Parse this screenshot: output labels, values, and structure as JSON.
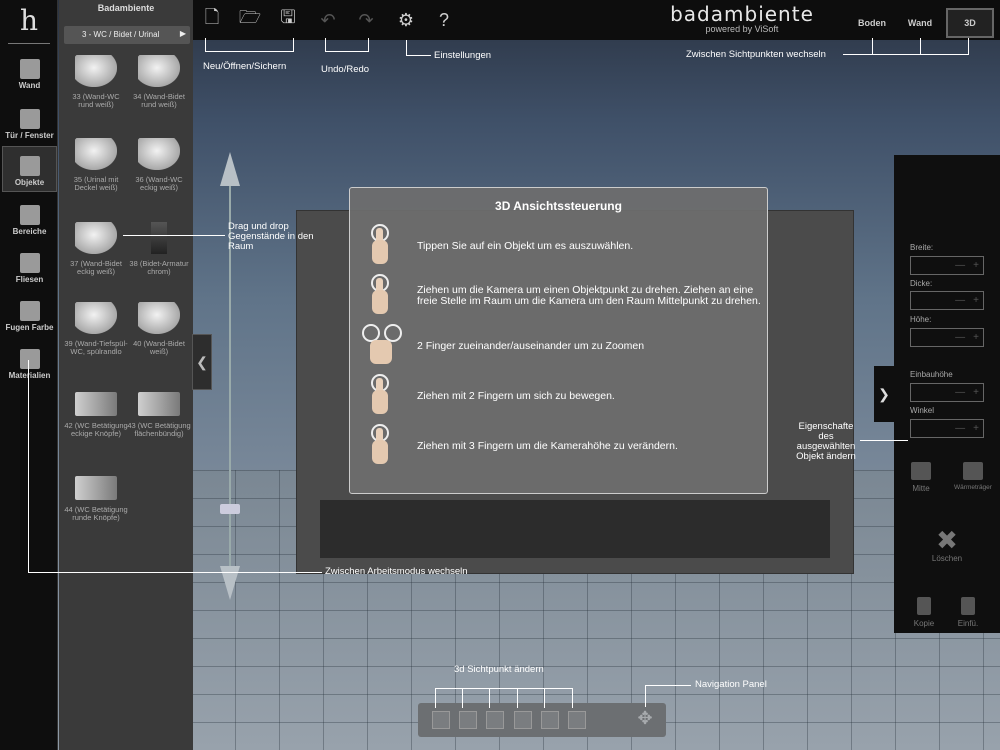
{
  "app": {
    "brand_name": "badambiente",
    "brand_sub": "powered by ViSoft"
  },
  "views": {
    "floor": "Boden",
    "wall": "Wand",
    "three_d": "3D",
    "active": "3D"
  },
  "modes": [
    {
      "label": "Wand",
      "icon": "wall-icon"
    },
    {
      "label": "Tür / Fenster",
      "icon": "door-icon"
    },
    {
      "label": "Objekte",
      "icon": "objects-icon"
    },
    {
      "label": "Bereiche",
      "icon": "areas-icon"
    },
    {
      "label": "Fliesen",
      "icon": "tiles-icon"
    },
    {
      "label": "Fugen Farbe",
      "icon": "grout-icon"
    },
    {
      "label": "Materialien",
      "icon": "materials-icon"
    }
  ],
  "catalog": {
    "title": "Badambiente",
    "category": "3 - WC / Bidet / Urinal",
    "items": [
      {
        "label": "33 (Wand-WC rund weiß)"
      },
      {
        "label": "34 (Wand-Bidet rund weiß)"
      },
      {
        "label": "35 (Urinal mit Deckel weiß)"
      },
      {
        "label": "36 (Wand-WC eckig weiß)"
      },
      {
        "label": "37 (Wand-Bidet eckig weiß)"
      },
      {
        "label": "38 (Bidet-Armatur chrom)"
      },
      {
        "label": "39 (Wand-Tiefspül-WC, spülrandlo"
      },
      {
        "label": "40 (Wand-Bidet weiß)"
      },
      {
        "label": "42 (WC Betätigung eckige Knöpfe)"
      },
      {
        "label": "43 (WC Betätigung flächenbündig)"
      },
      {
        "label": "44 (WC Betätigung runde Knöpfe)"
      }
    ]
  },
  "dialog": {
    "title": "3D Ansichtssteuerung",
    "hints": [
      "Tippen Sie auf ein Objekt um es auszuwählen.",
      "Ziehen um die Kamera um einen Objektpunkt zu drehen. Ziehen an eine freie Stelle im Raum um die Kamera um den Raum Mittelpunkt zu drehen.",
      "2 Finger zueinander/auseinander um zu Zoomen",
      "Ziehen mit 2 Fingern um sich zu bewegen.",
      "Ziehen mit 3 Fingern um die Kamerahöhe zu verändern."
    ]
  },
  "properties": {
    "width_label": "Breite:",
    "thickness_label": "Dicke:",
    "height_label": "Höhe:",
    "install_height_label": "Einbauhöhe",
    "angle_label": "Winkel",
    "center_label": "Mitte",
    "heating_label": "Wärmeträger",
    "delete_label": "Löschen",
    "copy_label": "Kopie",
    "paste_label": "Einfü."
  },
  "annotations": {
    "file_ops": "Neu/Öffnen/Sichern",
    "undo_redo": "Undo/Redo",
    "settings": "Einstellungen",
    "switch_view": "Zwischen Sichtpunkten wechseln",
    "drag_drop": "Drag und drop Gegenstände in den Raum",
    "switch_mode": "Zwischen Arbeitsmodus wechseln",
    "properties": "Eigenschafte des ausgewählten Objekt ändern",
    "change_3d_view": "3d Sichtpunkt ändern",
    "nav_panel": "Navigation Panel"
  }
}
